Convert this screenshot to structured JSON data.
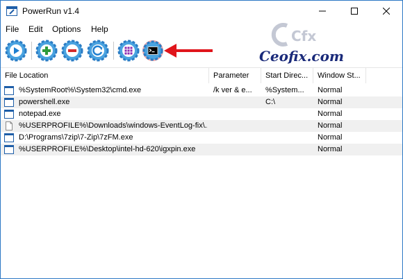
{
  "window": {
    "title": "PowerRun v1.4",
    "icon": "powerrun-app-icon",
    "controls": [
      "minimize-icon",
      "maximize-icon",
      "close-icon"
    ]
  },
  "menu": [
    "File",
    "Edit",
    "Options",
    "Help"
  ],
  "watermark": {
    "logo": "Cfx",
    "text": "Ceofix.com"
  },
  "toolbar": {
    "buttons": [
      {
        "name": "run-button",
        "icon": "play-icon"
      },
      {
        "name": "add-button",
        "icon": "plus-icon"
      },
      {
        "name": "remove-button",
        "icon": "minus-icon"
      },
      {
        "name": "refresh-button",
        "icon": "refresh-icon"
      },
      {
        "name": "grid-button",
        "icon": "grid-icon"
      },
      {
        "name": "cmd-button",
        "icon": "cmd-icon"
      }
    ]
  },
  "columns": [
    "File Location",
    "Parameter",
    "Start Direc...",
    "Window St..."
  ],
  "rows": [
    {
      "file": "%SystemRoot%\\System32\\cmd.exe",
      "param": "/k ver & e...",
      "start": "%System...",
      "window": "Normal",
      "icon": "window-icon"
    },
    {
      "file": "powershell.exe",
      "param": "",
      "start": "C:\\",
      "window": "Normal",
      "icon": "window-icon"
    },
    {
      "file": "notepad.exe",
      "param": "",
      "start": "",
      "window": "Normal",
      "icon": "window-icon"
    },
    {
      "file": "%USERPROFILE%\\Downloads\\windows-EventLog-fix\\...",
      "param": "",
      "start": "",
      "window": "Normal",
      "icon": "file-icon"
    },
    {
      "file": "D:\\Programs\\7zip\\7-Zip\\7zFM.exe",
      "param": "",
      "start": "",
      "window": "Normal",
      "icon": "window-icon"
    },
    {
      "file": "%USERPROFILE%\\Desktop\\intel-hd-620\\igxpin.exe",
      "param": "",
      "start": "",
      "window": "Normal",
      "icon": "window-icon"
    }
  ],
  "colors": {
    "accent": "#1e7fd0",
    "window_border": "#2b78c5",
    "arrow": "#e0151b",
    "alt_row": "#f0f0f0",
    "watermark": "#1a2a7a"
  }
}
